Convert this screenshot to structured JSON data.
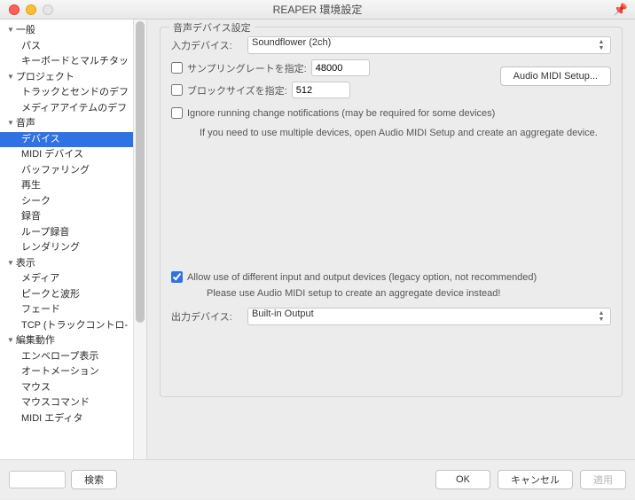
{
  "window": {
    "title": "REAPER 環境設定"
  },
  "sidebar": {
    "items": [
      {
        "label": "一般",
        "type": "parent"
      },
      {
        "label": "パス",
        "type": "child"
      },
      {
        "label": "キーボードとマルチタッ",
        "type": "child"
      },
      {
        "label": "プロジェクト",
        "type": "parent"
      },
      {
        "label": "トラックとセンドのデフ",
        "type": "child"
      },
      {
        "label": "メディアアイテムのデフ",
        "type": "child"
      },
      {
        "label": "音声",
        "type": "parent"
      },
      {
        "label": "デバイス",
        "type": "child",
        "selected": true
      },
      {
        "label": "MIDI デバイス",
        "type": "child"
      },
      {
        "label": "バッファリング",
        "type": "child"
      },
      {
        "label": "再生",
        "type": "child"
      },
      {
        "label": "シーク",
        "type": "child"
      },
      {
        "label": "録音",
        "type": "child"
      },
      {
        "label": "ループ録音",
        "type": "child"
      },
      {
        "label": "レンダリング",
        "type": "child"
      },
      {
        "label": "表示",
        "type": "parent"
      },
      {
        "label": "メディア",
        "type": "child"
      },
      {
        "label": "ピークと波形",
        "type": "child"
      },
      {
        "label": "フェード",
        "type": "child"
      },
      {
        "label": "TCP (トラックコントロ-",
        "type": "child"
      },
      {
        "label": "編集動作",
        "type": "parent"
      },
      {
        "label": "エンベロープ表示",
        "type": "child"
      },
      {
        "label": "オートメーション",
        "type": "child"
      },
      {
        "label": "マウス",
        "type": "child"
      },
      {
        "label": "マウスコマンド",
        "type": "child"
      },
      {
        "label": "MIDI エディタ",
        "type": "child"
      }
    ]
  },
  "panel": {
    "legend": "音声デバイス設定",
    "input_label": "入力デバイス:",
    "input_device": "Soundflower (2ch)",
    "sr_check_label": "サンプリングレートを指定:",
    "sr_value": "48000",
    "bs_check_label": "ブロックサイズを指定:",
    "bs_value": "512",
    "audio_midi_btn": "Audio MIDI Setup...",
    "ignore_label": "Ignore running change notifications (may be required for some devices)",
    "aggregate_hint": "If you need to use multiple devices, open Audio MIDI Setup and create an aggregate device.",
    "allow_diff_label": "Allow use of different input and output devices (legacy option, not recommended)",
    "allow_diff_hint": "Please use Audio MIDI setup to create an aggregate device instead!",
    "output_label": "出力デバイス:",
    "output_device": "Built-in Output"
  },
  "footer": {
    "search_btn": "検索",
    "ok": "OK",
    "cancel": "キャンセル",
    "apply": "適用"
  }
}
